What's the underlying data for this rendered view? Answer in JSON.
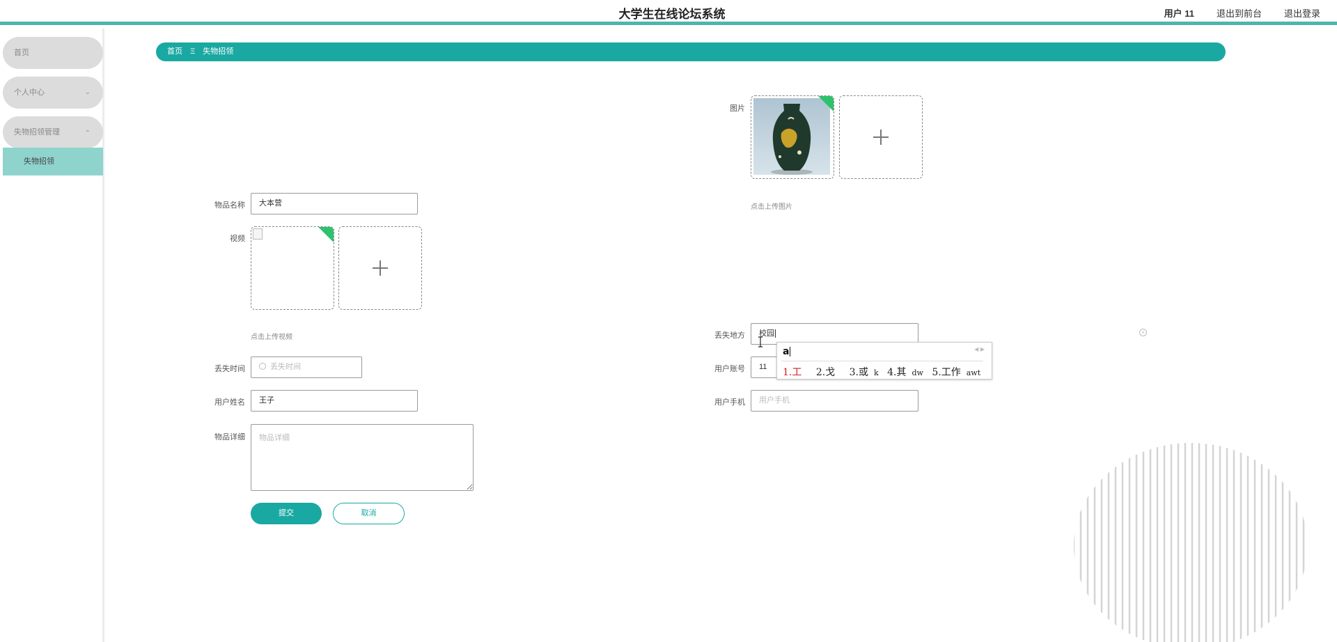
{
  "header": {
    "title": "大学生在线论坛系统",
    "user": "用户 11",
    "to_front": "退出到前台",
    "logout": "退出登录"
  },
  "sidebar": {
    "items": [
      {
        "label": "首页"
      },
      {
        "label": "个人中心"
      },
      {
        "label": "失物招领管理"
      }
    ],
    "sub_item": "失物招领"
  },
  "breadcrumb": {
    "home": "首页",
    "separator": "Ξ",
    "current": "失物招领"
  },
  "form": {
    "image_label": "图片",
    "image_hint": "点击上传图片",
    "name_label": "物品名称",
    "name_value": "大本营",
    "video_label": "视频",
    "video_hint": "点击上传视频",
    "lost_place_label": "丢失地方",
    "lost_place_value": "校园",
    "lost_time_label": "丢失时间",
    "lost_time_placeholder": "丢失时间",
    "account_label": "用户账号",
    "account_value": "11",
    "username_label": "用户姓名",
    "username_value": "王子",
    "phone_label": "用户手机",
    "phone_placeholder": "用户手机",
    "detail_label": "物品详细",
    "detail_placeholder": "物品详细",
    "submit": "提交",
    "cancel": "取消"
  },
  "ime": {
    "composition": "a",
    "candidates": [
      "1.工",
      "2.戈",
      "3.或",
      "4.其",
      "5.工作"
    ],
    "hints": [
      "",
      "",
      "k",
      "dw",
      "awt"
    ]
  },
  "colors": {
    "accent": "#1aa9a2",
    "sub_menu": "#8fd3cd",
    "corner": "#2ec26d"
  }
}
